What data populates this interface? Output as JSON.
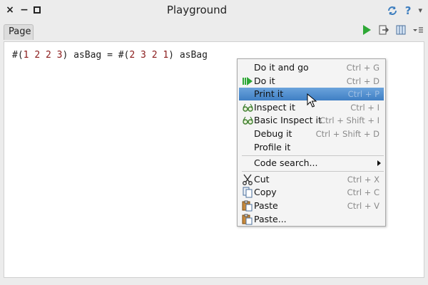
{
  "window": {
    "title": "Playground",
    "close_glyph": "×",
    "minimize_glyph": "−",
    "help_glyph": "?",
    "dropdown_glyph": "▾"
  },
  "tabs": [
    {
      "label": "Page"
    }
  ],
  "editor": {
    "code_parts": [
      {
        "t": "#(",
        "k": "p"
      },
      {
        "t": "1",
        "k": "n"
      },
      {
        "t": " ",
        "k": "p"
      },
      {
        "t": "2",
        "k": "n"
      },
      {
        "t": " ",
        "k": "p"
      },
      {
        "t": "2",
        "k": "n"
      },
      {
        "t": " ",
        "k": "p"
      },
      {
        "t": "3",
        "k": "n"
      },
      {
        "t": ") asBag = #(",
        "k": "p"
      },
      {
        "t": "2",
        "k": "n"
      },
      {
        "t": " ",
        "k": "p"
      },
      {
        "t": "3",
        "k": "n"
      },
      {
        "t": " ",
        "k": "p"
      },
      {
        "t": "2",
        "k": "n"
      },
      {
        "t": " ",
        "k": "p"
      },
      {
        "t": "1",
        "k": "n"
      },
      {
        "t": ") asBag",
        "k": "p"
      }
    ]
  },
  "context_menu": {
    "items": [
      {
        "label": "Do it and go",
        "shortcut": "Ctrl + G",
        "icon": "none"
      },
      {
        "label": "Do it",
        "shortcut": "Ctrl + D",
        "icon": "play-icon"
      },
      {
        "label": "Print it",
        "shortcut": "Ctrl + P",
        "icon": "none",
        "selected": true
      },
      {
        "label": "Inspect it",
        "shortcut": "Ctrl + I",
        "icon": "glasses-icon"
      },
      {
        "label": "Basic Inspect it",
        "shortcut": "Ctrl + Shift + I",
        "icon": "glasses-icon"
      },
      {
        "label": "Debug it",
        "shortcut": "Ctrl + Shift + D",
        "icon": "none"
      },
      {
        "label": "Profile it",
        "shortcut": "",
        "icon": "none"
      },
      {
        "label": "Code search...",
        "shortcut": "",
        "icon": "none",
        "submenu": true
      },
      {
        "label": "Cut",
        "shortcut": "Ctrl + X",
        "icon": "scissors-icon"
      },
      {
        "label": "Copy",
        "shortcut": "Ctrl + C",
        "icon": "copy-icon"
      },
      {
        "label": "Paste",
        "shortcut": "Ctrl + V",
        "icon": "paste-icon"
      },
      {
        "label": "Paste...",
        "shortcut": "",
        "icon": "paste-icon"
      }
    ]
  },
  "colors": {
    "selection": "#4a8ad0",
    "number": "#8a1a1a",
    "accent_blue": "#3f7fbf",
    "run_green": "#2ea836"
  }
}
